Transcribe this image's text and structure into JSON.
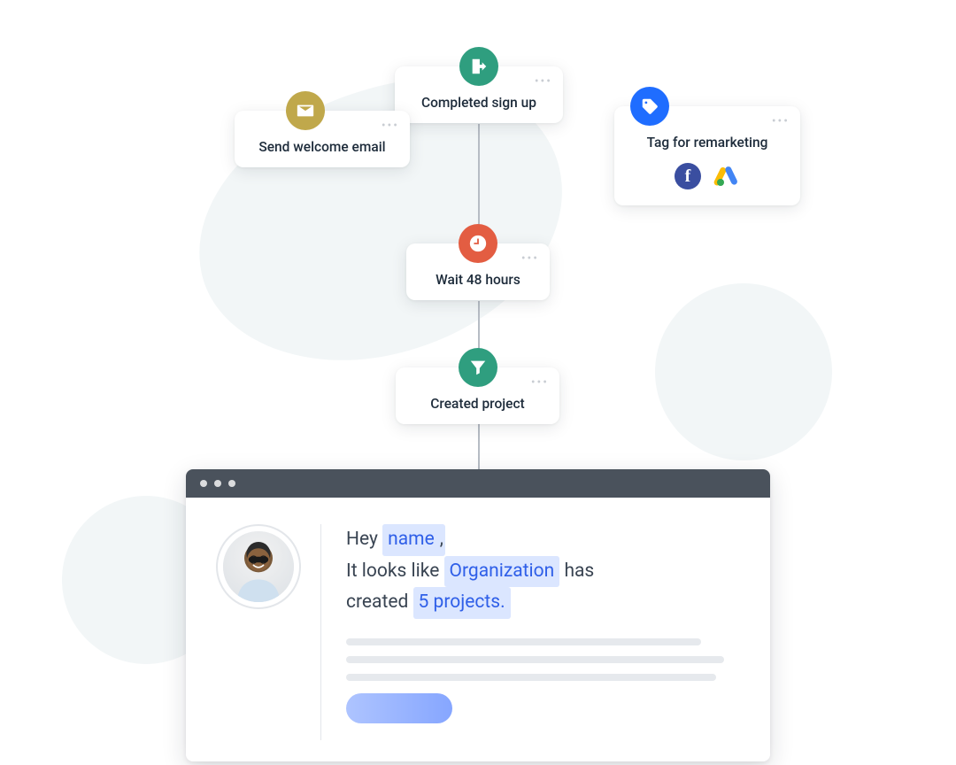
{
  "flow": {
    "trigger": {
      "label": "Completed sign up",
      "icon": "door-icon",
      "color": "#2f9e7f"
    },
    "branches": {
      "left": {
        "label": "Send welcome email",
        "icon": "mail-icon",
        "color": "#c0a84b"
      },
      "right": {
        "label": "Tag for remarketing",
        "icon": "tag-icon",
        "color": "#1f6dff",
        "brands": [
          "facebook",
          "google-ads"
        ]
      }
    },
    "wait": {
      "label": "Wait 48 hours",
      "icon": "clock-icon",
      "color": "#e35d42"
    },
    "filter": {
      "label": "Created project",
      "icon": "funnel-icon",
      "color": "#2f9e7f"
    }
  },
  "message_preview": {
    "greeting_prefix": "Hey ",
    "name_token": "name",
    "greeting_suffix": ",",
    "line2_prefix": "It looks like ",
    "org_token": "Organization",
    "line2_mid": " has",
    "line3_prefix": "created ",
    "count_token": "5 projects."
  },
  "colors": {
    "chip_bg": "#dbe6ff",
    "chip_text": "#2f5fe8",
    "titlebar": "#4a525c",
    "blob": "#f2f6f7"
  }
}
